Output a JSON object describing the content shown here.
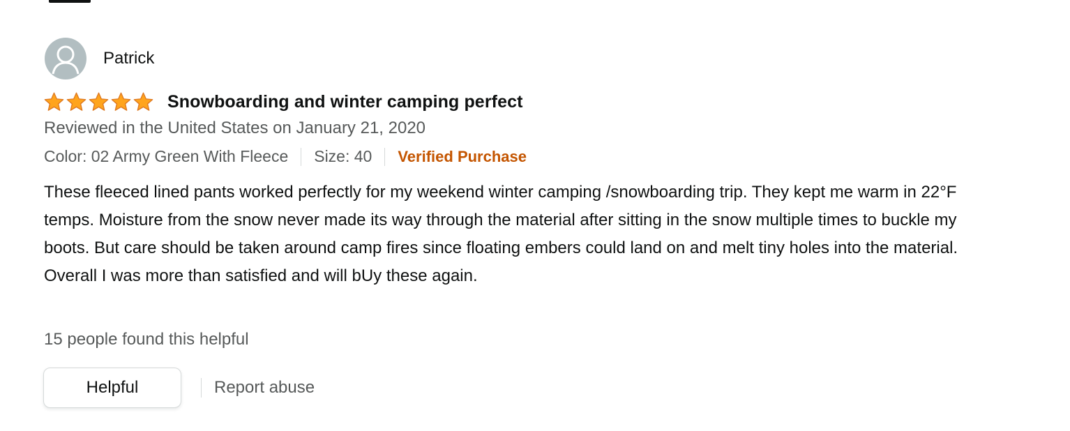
{
  "review": {
    "profile_name": "Patrick",
    "rating": 5,
    "rating_max": 5,
    "star_color": "#ffa41c",
    "title": "Snowboarding and winter camping perfect",
    "date_line": "Reviewed in the United States on January 21, 2020",
    "color_label": "Color: 02 Army Green With Fleece",
    "size_label": "Size: 40",
    "verified_label": "Verified Purchase",
    "verified_color": "#c45500",
    "body": "These fleeced lined pants worked perfectly for my weekend winter camping /snowboarding trip. They kept me warm in 22°F temps. Moisture from the snow never made its way through the material after sitting in the snow multiple times to buckle my boots. But care should be taken around camp fires since floating embers could land on and melt tiny holes into the material. Overall I was more than satisfied and will bUy these again.",
    "helpful_count_text": "15 people found this helpful"
  },
  "actions": {
    "helpful_label": "Helpful",
    "report_label": "Report abuse"
  },
  "icons": {
    "avatar": "user-avatar-icon",
    "star": "star-icon"
  }
}
